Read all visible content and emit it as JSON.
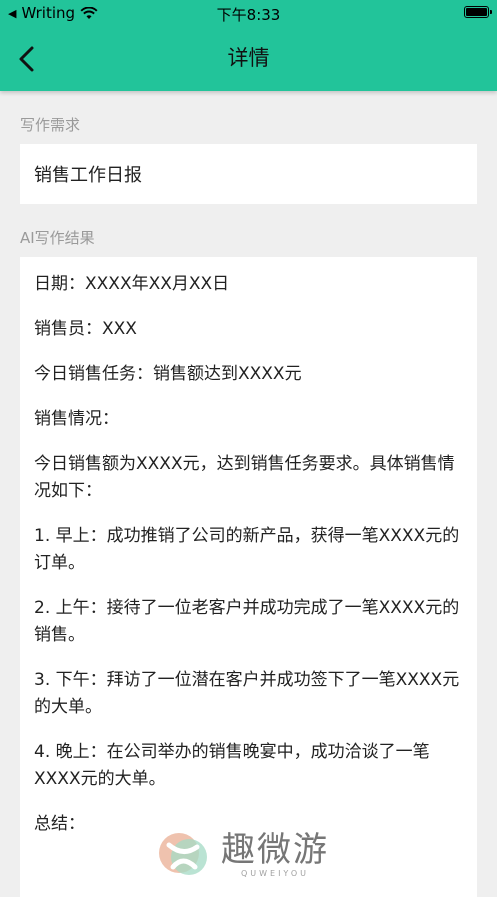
{
  "status_bar": {
    "carrier": "Writing",
    "time": "下午8:33"
  },
  "header": {
    "title": "详情"
  },
  "request": {
    "label": "写作需求",
    "value": "销售工作日报"
  },
  "result": {
    "label": "AI写作结果",
    "paragraphs": [
      "日期：XXXX年XX月XX日",
      "销售员：XXX",
      "今日销售任务：销售额达到XXXX元",
      "销售情况：",
      "今日销售额为XXXX元，达到销售任务要求。具体销售情况如下：",
      "1. 早上：成功推销了公司的新产品，获得一笔XXXX元的订单。",
      "2. 上午：接待了一位老客户并成功完成了一笔XXXX元的销售。",
      "3. 下午：拜访了一位潜在客户并成功签下了一笔XXXX元的大单。",
      "4. 晚上：在公司举办的销售晚宴中，成功洽谈了一笔XXXX元的大单。",
      "总结："
    ]
  },
  "watermark": {
    "name": "趣微游",
    "sub": "QUWEIYOU"
  },
  "colors": {
    "header": "#22c49a",
    "background": "#efefef"
  }
}
